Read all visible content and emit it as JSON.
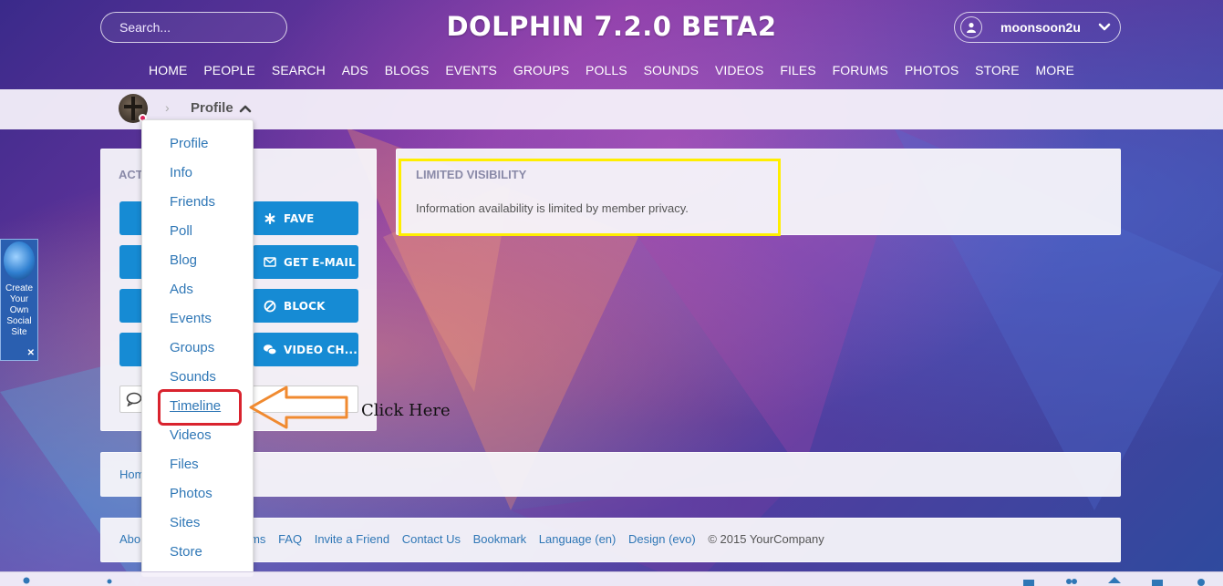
{
  "header": {
    "search_placeholder": "Search...",
    "site_title": "DOLPHIN 7.2.0 BETA2",
    "username": "moonsoon2u"
  },
  "nav": [
    "HOME",
    "PEOPLE",
    "SEARCH",
    "ADS",
    "BLOGS",
    "EVENTS",
    "GROUPS",
    "POLLS",
    "SOUNDS",
    "VIDEOS",
    "FILES",
    "FORUMS",
    "PHOTOS",
    "STORE",
    "MORE"
  ],
  "breadcrumb": {
    "separator": "›",
    "current": "Profile"
  },
  "actions": {
    "title_visible": "ACT",
    "buttons": [
      {
        "label": "FAVE",
        "icon": "asterisk-icon"
      },
      {
        "label": "GET E-MAIL",
        "icon": "envelope-icon"
      },
      {
        "label": "BLOCK",
        "icon": "block-icon"
      },
      {
        "label": "VIDEO CH...",
        "icon": "chat-bubbles-icon"
      }
    ]
  },
  "visibility": {
    "title": "LIMITED VISIBILITY",
    "text": "Information availability is limited by member privacy."
  },
  "page_crumb": "Hom",
  "footer": {
    "links": [
      "Abo",
      "rms",
      "FAQ",
      "Invite a Friend",
      "Contact Us",
      "Bookmark",
      "Language (en)",
      "Design (evo)"
    ],
    "copyright": "© 2015 YourCompany"
  },
  "profile_menu": {
    "items": [
      "Profile",
      "Info",
      "Friends",
      "Poll",
      "Blog",
      "Ads",
      "Events",
      "Groups",
      "Sounds",
      "Timeline",
      "Videos",
      "Files",
      "Photos",
      "Sites",
      "Store"
    ],
    "highlighted": "Timeline"
  },
  "annotation": {
    "callout": "Click Here",
    "box_color": "#d9232e",
    "arrow_color": "#f08a30",
    "visibility_box_color": "#ffee00"
  },
  "side_badge": {
    "lines": [
      "Create",
      "Your",
      "Own",
      "Social",
      "Site"
    ],
    "close": "✕"
  },
  "colors": {
    "button_blue": "#168bd4",
    "link_blue": "#2f77b6"
  }
}
